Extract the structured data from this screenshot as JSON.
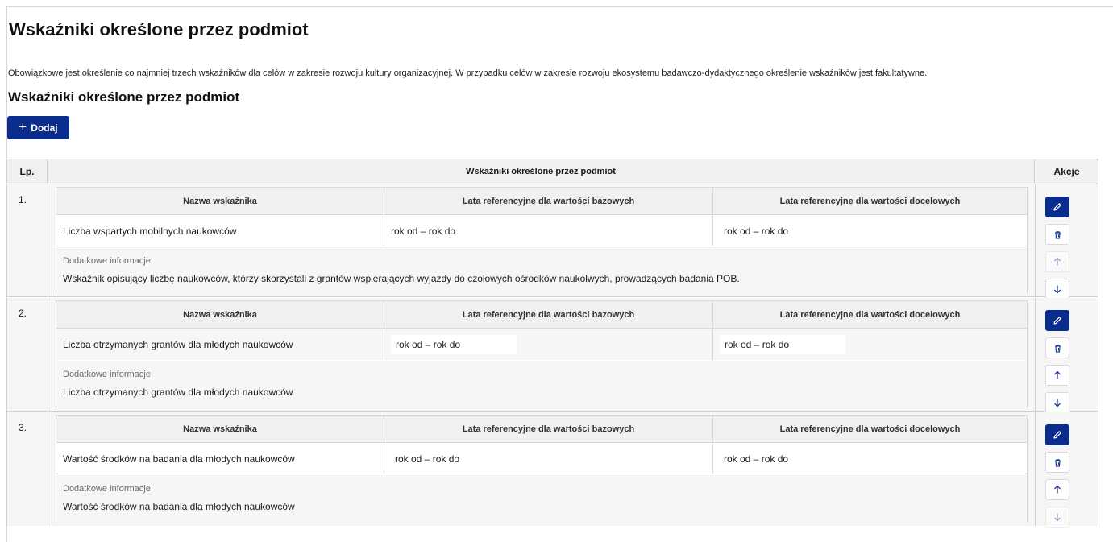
{
  "page": {
    "title": "Wskaźniki określone przez podmiot",
    "info": "Obowiązkowe jest określenie co najmniej trzech wskaźników dla celów w zakresie rozwoju kultury organizacyjnej. W przypadku celów w zakresie rozwoju ekosystemu badawczo-dydaktycznego określenie wskaźników jest fakultatywne.",
    "section_title": "Wskaźniki określone przez podmiot"
  },
  "toolbar": {
    "add_label": "Dodaj",
    "add_icon": "plus-icon"
  },
  "table": {
    "headers": {
      "lp": "Lp.",
      "main": "Wskaźniki określone przez podmiot",
      "actions": "Akcje"
    },
    "inner_headers": {
      "name": "Nazwa wskaźnika",
      "base": "Lata referencyjne dla wartości bazowych",
      "target": "Lata referencyjne dla wartości docelowych"
    },
    "extra_label": "Dodatkowe informacje",
    "rows": [
      {
        "lp": "1.",
        "name": "Liczba wspartych mobilnych naukowców",
        "base": "rok od – rok do",
        "target": "rok od – rok do",
        "extra": "Wskaźnik opisujący liczbę naukowców, którzy skorzystali z grantów wspierających wyjazdy do czołowych ośrodków naukolwych, prowadzących badania POB.",
        "up_enabled": false,
        "down_enabled": true
      },
      {
        "lp": "2.",
        "name": "Liczba otrzymanych grantów dla młodych naukowców",
        "base": "rok od – rok do",
        "target": "rok od – rok do",
        "extra": "Liczba otrzymanych grantów dla młodych naukowców",
        "up_enabled": true,
        "down_enabled": true
      },
      {
        "lp": "3.",
        "name": "Wartość środków na badania dla młodych naukowców",
        "base": "rok od – rok do",
        "target": "rok od – rok do",
        "extra": "Wartość środków na badania dla młodych naukowców",
        "up_enabled": true,
        "down_enabled": false
      }
    ]
  },
  "icons": {
    "edit": "pencil-icon",
    "delete": "trash-icon",
    "up": "arrow-up-icon",
    "down": "arrow-down-icon"
  },
  "colors": {
    "primary": "#0a2c8c",
    "header_bg": "#f0f0f0",
    "row_bg": "#f6f6f6"
  }
}
